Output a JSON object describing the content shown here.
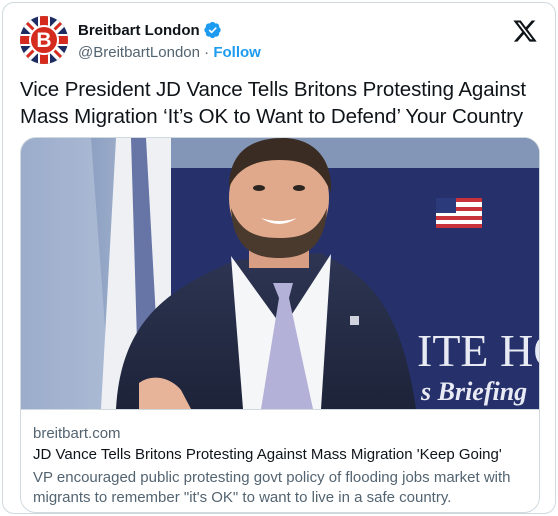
{
  "account": {
    "display_name": "Breitbart London",
    "handle": "@BreitbartLondon",
    "separator": "·",
    "follow_label": "Follow",
    "avatar_letter": "B"
  },
  "tweet": {
    "text": "Vice President JD Vance Tells Britons Protesting Against Mass Migration ‘It’s OK to Want to Defend’ Your Country"
  },
  "link_card": {
    "domain": "breitbart.com",
    "title": "JD Vance Tells Britons Protesting Against Mass Migration 'Keep Going'",
    "description": "VP encouraged public protesting govt policy of flooding jobs market with migrants to remember \"it's OK\" to want to live in a safe country.",
    "image_sign_line1": "ITE HOU",
    "image_sign_line2": "s Briefing"
  },
  "icons": {
    "verified": "verified-badge-icon",
    "x_logo": "x-logo-icon"
  },
  "colors": {
    "accent": "#1d9bf0",
    "secondary_text": "#536471",
    "border": "#cfd9de",
    "avatar_red": "#d52b1e",
    "avatar_navy": "#1d2d63"
  }
}
